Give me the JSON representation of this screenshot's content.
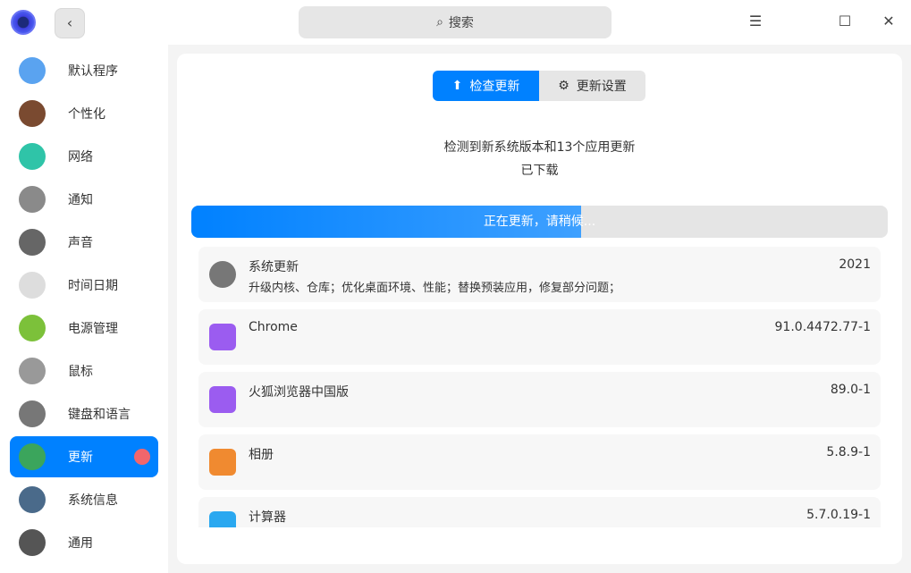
{
  "search": {
    "placeholder": "搜索"
  },
  "sidebar": {
    "items": [
      {
        "label": "默认程序",
        "icon": "default-apps-icon",
        "color": "#5aa3f0"
      },
      {
        "label": "个性化",
        "icon": "personalization-icon",
        "color": "#7a4a30"
      },
      {
        "label": "网络",
        "icon": "network-icon",
        "color": "#2fc4a8"
      },
      {
        "label": "通知",
        "icon": "notification-bell-icon",
        "color": "#8a8a8a"
      },
      {
        "label": "声音",
        "icon": "sound-icon",
        "color": "#666"
      },
      {
        "label": "时间日期",
        "icon": "clock-icon",
        "color": "#ddd"
      },
      {
        "label": "电源管理",
        "icon": "battery-icon",
        "color": "#7cc13a"
      },
      {
        "label": "鼠标",
        "icon": "mouse-icon",
        "color": "#999"
      },
      {
        "label": "键盘和语言",
        "icon": "keyboard-icon",
        "color": "#777"
      },
      {
        "label": "更新",
        "icon": "update-icon",
        "color": "#3ba55c",
        "active": true
      },
      {
        "label": "系统信息",
        "icon": "system-info-icon",
        "color": "#4a6a8a"
      },
      {
        "label": "通用",
        "icon": "general-gear-icon",
        "color": "#555"
      }
    ]
  },
  "tabs": {
    "check": "检查更新",
    "settings": "更新设置"
  },
  "status": {
    "line1": "检测到新系统版本和13个应用更新",
    "line2": "已下载"
  },
  "progress": {
    "label": "正在更新，请稍候...",
    "percent": 56
  },
  "updates": [
    {
      "name": "系统更新",
      "desc": "升级内核、仓库；优化桌面环境、性能；替换预装应用，修复部分问题；",
      "version": "2021",
      "icon": "gear-icon",
      "color": "#777"
    },
    {
      "name": "Chrome",
      "desc": "",
      "version": "91.0.4472.77-1",
      "icon": "package-icon",
      "color": "#9b5cf0"
    },
    {
      "name": "火狐浏览器中国版",
      "desc": "",
      "version": "89.0-1",
      "icon": "package-icon",
      "color": "#9b5cf0"
    },
    {
      "name": "相册",
      "desc": "",
      "version": "5.8.9-1",
      "icon": "album-icon",
      "color": "#f08a30"
    },
    {
      "name": "计算器",
      "desc": "",
      "version": "5.7.0.19-1",
      "icon": "calculator-icon",
      "color": "#2aa8f0"
    }
  ]
}
